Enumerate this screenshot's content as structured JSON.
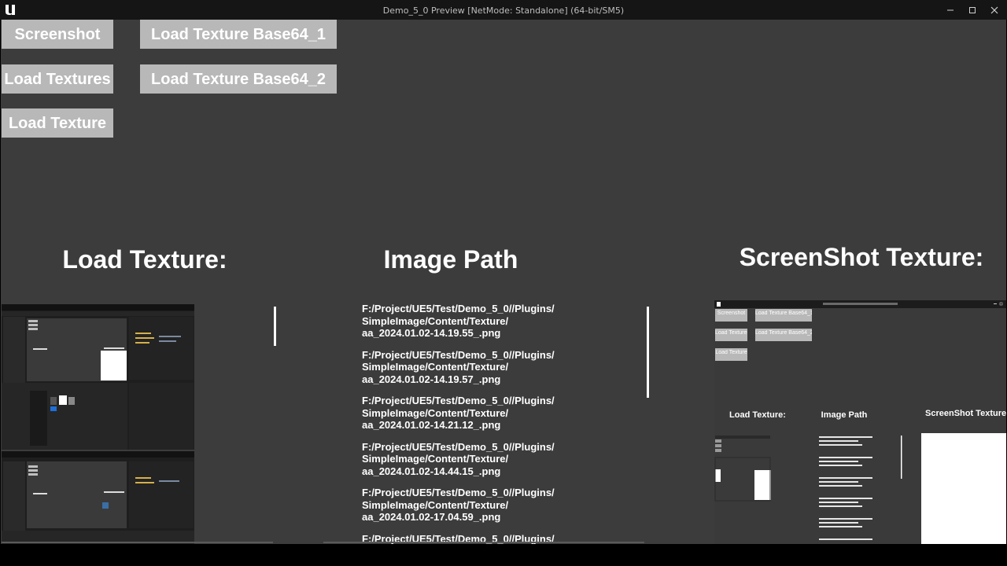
{
  "window": {
    "title": "Demo_5_0 Preview [NetMode: Standalone]  (64-bit/SM5)",
    "controls": [
      "minimize-icon",
      "maximize-icon",
      "close-icon"
    ],
    "logo": "unreal-engine-logo"
  },
  "buttons": {
    "screenshot": "Screenshot",
    "load_textures": "Load Textures",
    "load_texture": "Load Texture",
    "load_base64_1": "Load Texture Base64_1",
    "load_base64_2": "Load Texture Base64_2"
  },
  "headings": {
    "load_texture": "Load Texture:",
    "image_path": "Image Path",
    "screenshot_texture": "ScreenShot Texture:"
  },
  "image_paths": [
    "F:/Project/UE5/Test/Demo_5_0//Plugins/\nSimpleImage/Content/Texture/\naa_2024.01.02-14.19.55_.png",
    "F:/Project/UE5/Test/Demo_5_0//Plugins/\nSimpleImage/Content/Texture/\naa_2024.01.02-14.19.57_.png",
    "F:/Project/UE5/Test/Demo_5_0//Plugins/\nSimpleImage/Content/Texture/\naa_2024.01.02-14.21.12_.png",
    "F:/Project/UE5/Test/Demo_5_0//Plugins/\nSimpleImage/Content/Texture/\naa_2024.01.02-14.44.15_.png",
    "F:/Project/UE5/Test/Demo_5_0//Plugins/\nSimpleImage/Content/Texture/\naa_2024.01.02-17.04.59_.png",
    "F:/Project/UE5/Test/Demo_5_0//Plugins/"
  ],
  "screenshot_preview": {
    "buttons": [
      "Screenshot",
      "Load Texture Base64_1",
      "Load Textures",
      "Load Texture Base64_2",
      "Load Texture"
    ],
    "headings": [
      "Load Texture:",
      "Image Path",
      "ScreenShot Texture:"
    ]
  },
  "colors": {
    "viewport_bg": "#3c3c3c",
    "button_bg": "#b8b8b8",
    "titlebar_bg": "#151515"
  }
}
